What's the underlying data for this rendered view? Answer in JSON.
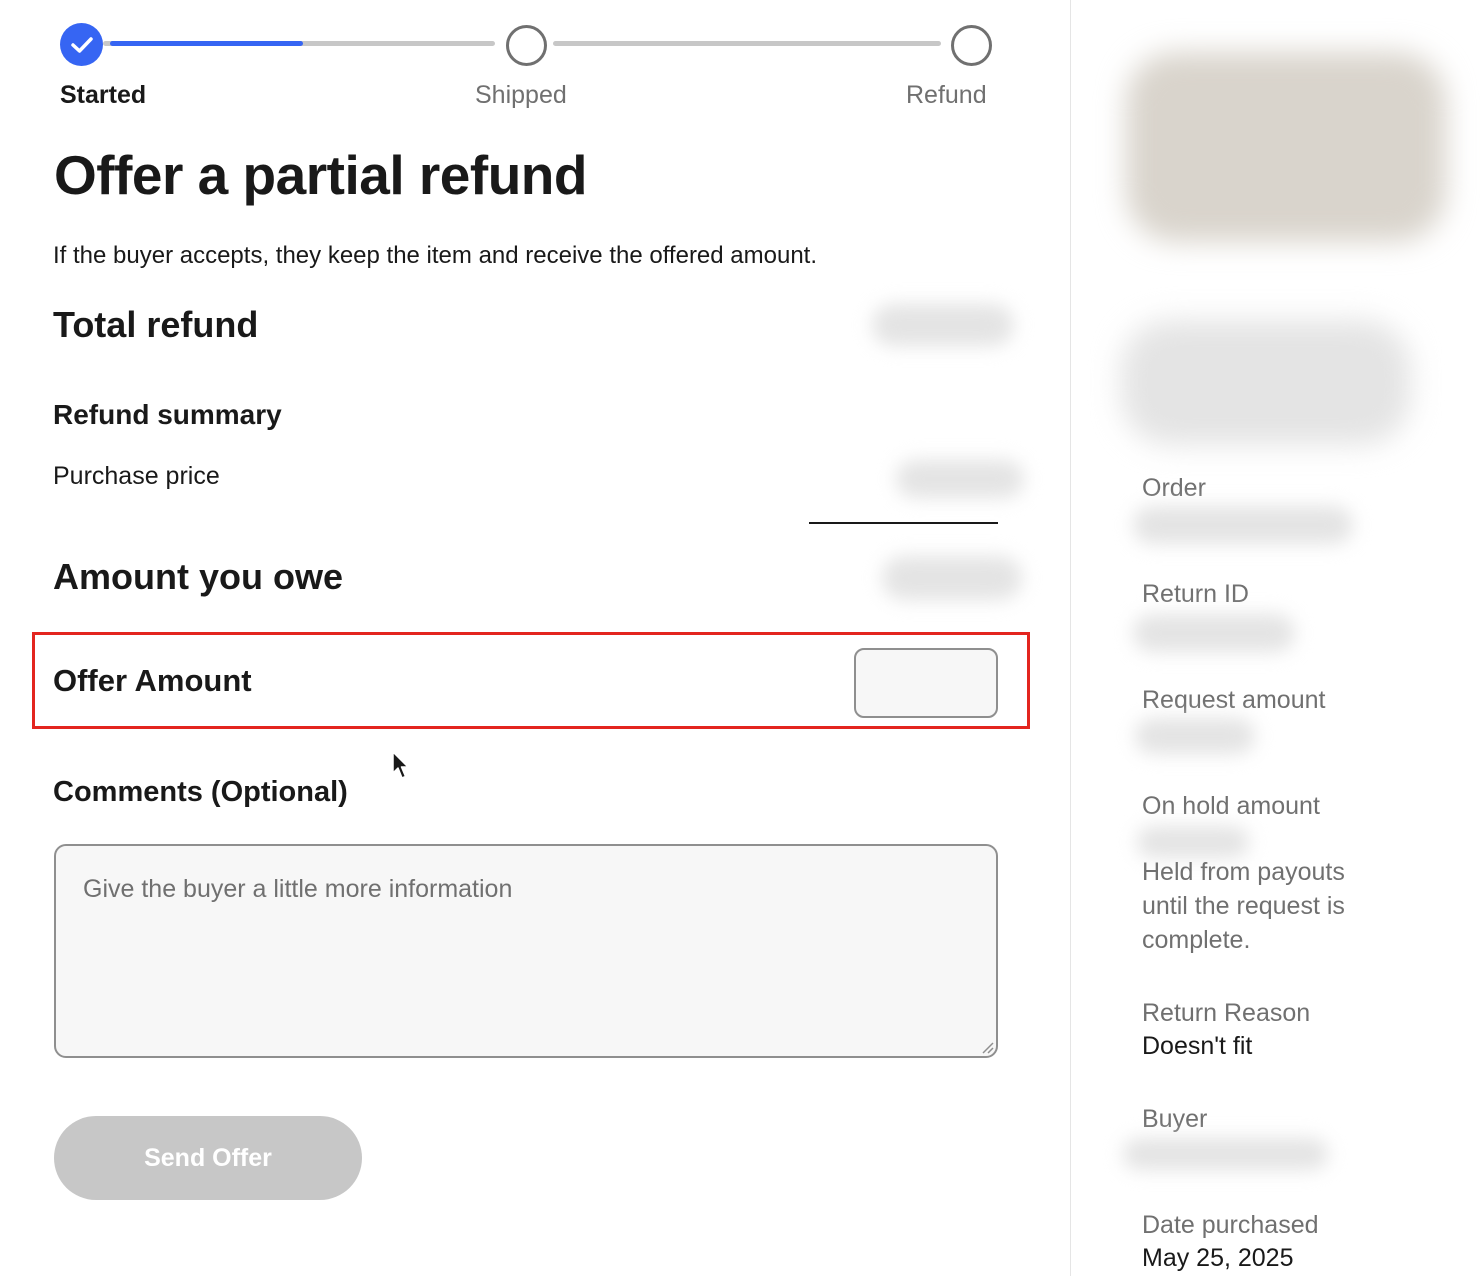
{
  "progress": {
    "steps": [
      {
        "label": "Started",
        "state": "complete"
      },
      {
        "label": "Shipped",
        "state": "pending"
      },
      {
        "label": "Refund",
        "state": "pending"
      }
    ],
    "completion": 0.43
  },
  "page": {
    "title": "Offer a partial refund",
    "subtitle": "If the buyer accepts, they keep the item and receive the offered amount."
  },
  "refund": {
    "total_label": "Total refund",
    "summary_heading": "Refund summary",
    "purchase_price_label": "Purchase price",
    "amount_owe_label": "Amount you owe"
  },
  "offer": {
    "label": "Offer Amount",
    "value": "",
    "highlight_color": "#e3251f"
  },
  "comments": {
    "label": "Comments (Optional)",
    "placeholder": "Give the buyer a little more information",
    "value": ""
  },
  "actions": {
    "send_label": "Send Offer",
    "send_enabled": false
  },
  "sidebar": {
    "order_label": "Order",
    "return_id_label": "Return ID",
    "request_amount_label": "Request amount",
    "on_hold_label": "On hold amount",
    "on_hold_note": "Held from payouts until the request is complete.",
    "return_reason_label": "Return Reason",
    "return_reason_value": "Doesn't fit",
    "buyer_label": "Buyer",
    "date_purchased_label": "Date purchased",
    "date_purchased_value": "May 25, 2025"
  },
  "colors": {
    "accent": "#3665f3",
    "text": "#191919",
    "muted": "#707070",
    "disabled_button": "#c7c7c7"
  },
  "icons": [
    "check-icon",
    "cursor-icon",
    "resize-grip-icon"
  ]
}
